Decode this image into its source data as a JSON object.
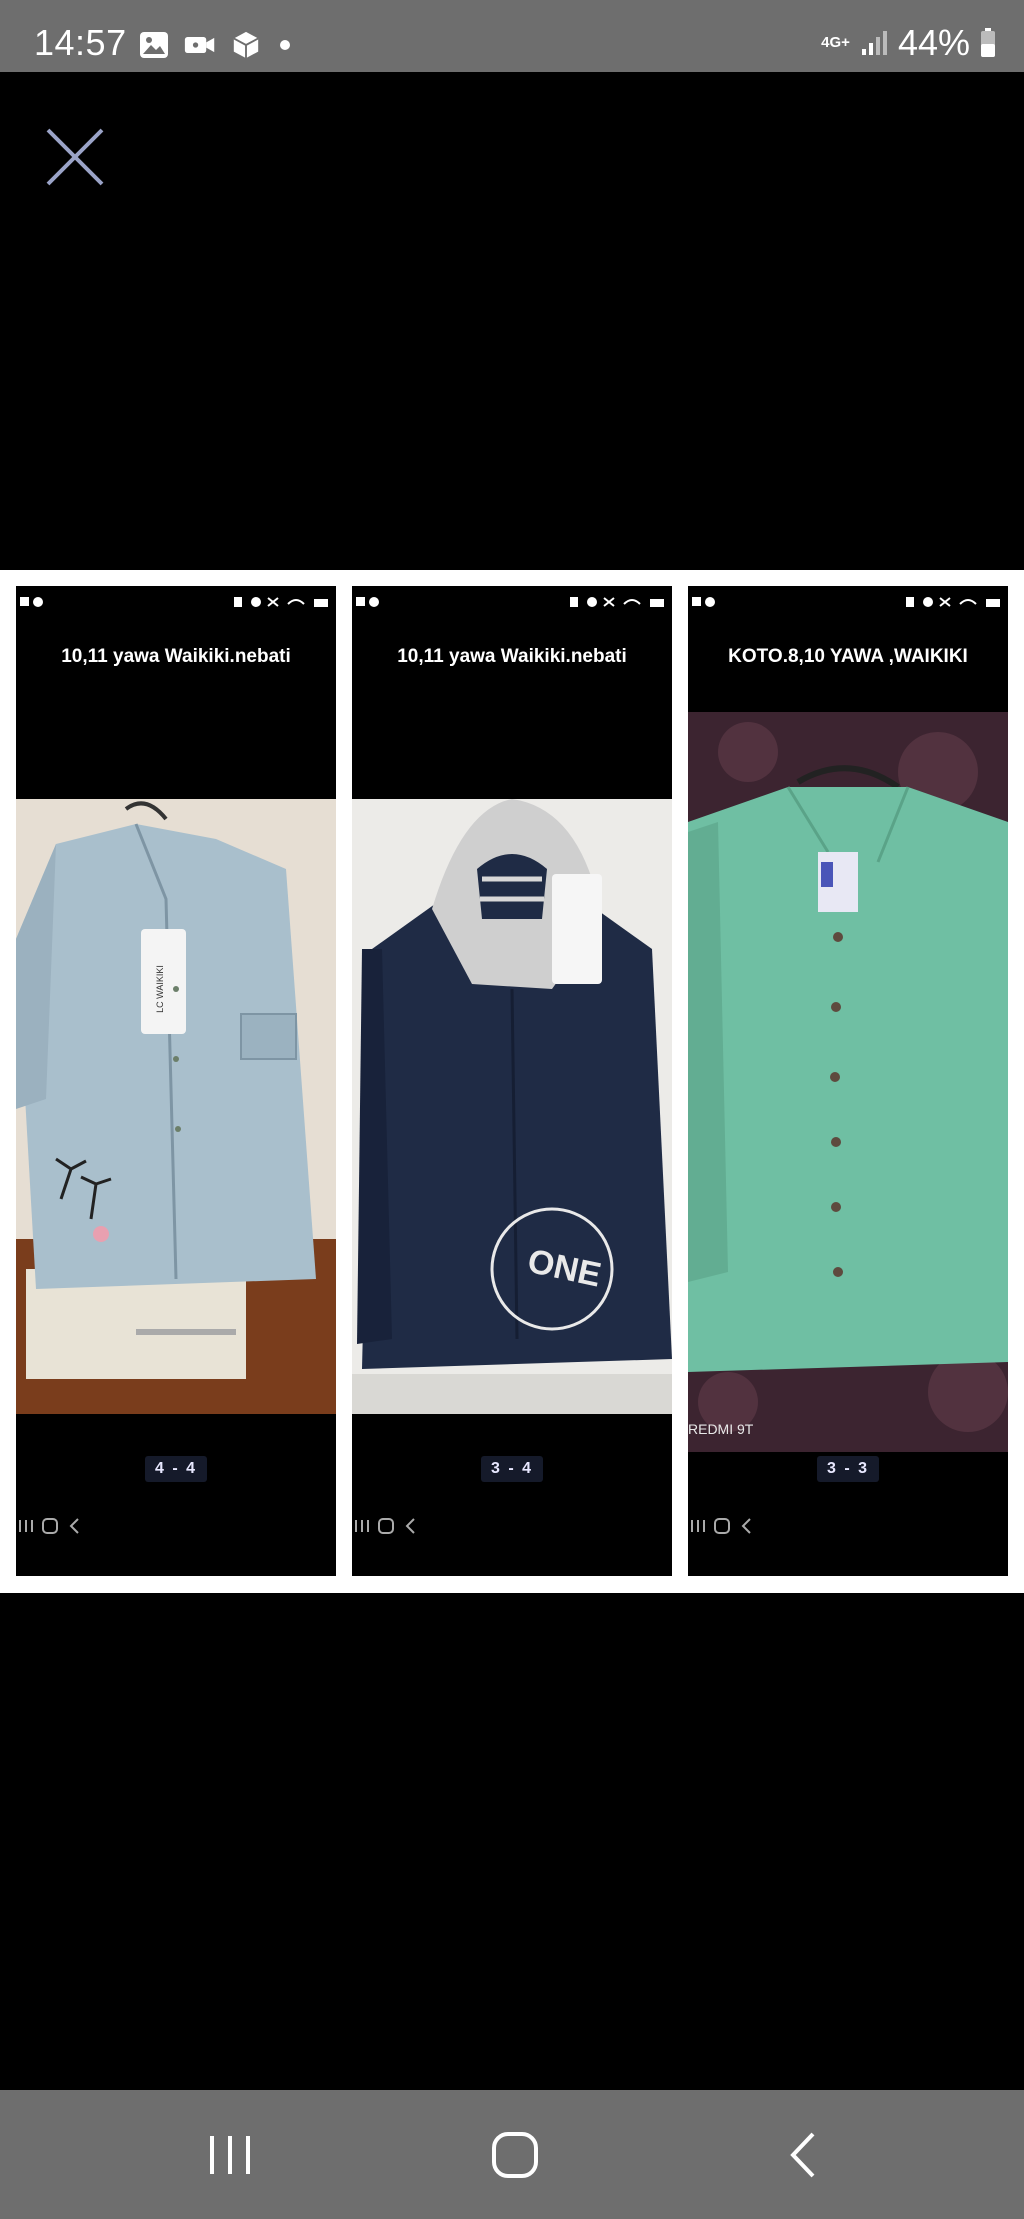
{
  "status_bar": {
    "time": "14:57",
    "network": "4G+",
    "battery": "44%",
    "icons": [
      "gallery-icon",
      "video-icon",
      "box-icon",
      "dot-icon",
      "signal-icon",
      "battery-icon"
    ]
  },
  "viewer": {
    "close_icon": "close-icon",
    "panels": [
      {
        "title": "10,11 yawa Waikiki.nebati",
        "counter": "4 - 4",
        "shirt_color": "#a9bfcc"
      },
      {
        "title": "10,11 yawa Waikiki.nebati",
        "counter": "3 - 4",
        "shirt_color": "#1f2b45"
      },
      {
        "title": "KOTO.8,10 YAWA ,WAIKIKI",
        "counter": "3 - 3",
        "shirt_color": "#6fbfa3",
        "watermark": "REDMI 9T"
      }
    ],
    "tag_text": "LC WAIKIKI",
    "print_text": "ONE"
  },
  "nav_bar": {
    "recents_icon": "recents-icon",
    "home_icon": "home-icon",
    "back_icon": "back-icon"
  }
}
